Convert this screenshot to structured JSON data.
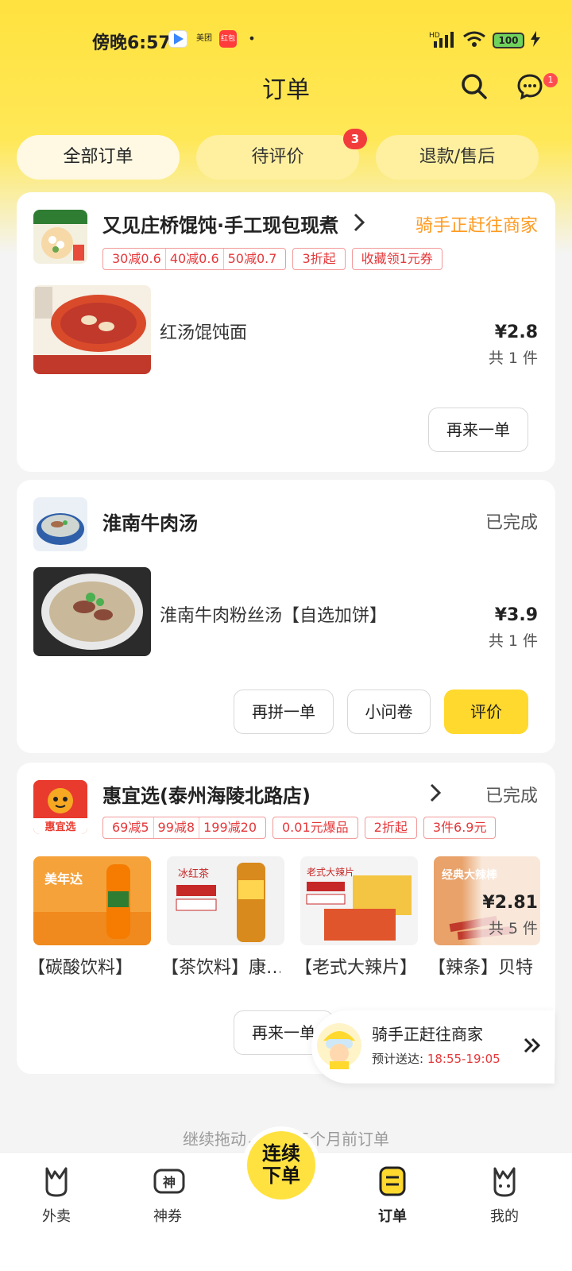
{
  "status_bar": {
    "time": "傍晚6:57",
    "app_meituan": "美团",
    "app_red": "红包",
    "dot": "•",
    "network": "HD",
    "battery": "100"
  },
  "header": {
    "title": "订单",
    "message_badge": "1"
  },
  "tabs": [
    {
      "label": "全部订单",
      "active": true
    },
    {
      "label": "待评价",
      "badge": "3"
    },
    {
      "label": "退款/售后"
    }
  ],
  "orders": [
    {
      "shop_name": "又见庄桥馄饨·手工现包现煮",
      "status": "骑手正赶往商家",
      "status_color": "#ff9a1f",
      "promos": [
        [
          "30减0.6",
          "40减0.6",
          "50减0.7"
        ],
        [
          "3折起"
        ],
        [
          "收藏领1元券"
        ]
      ],
      "item_name": "红汤馄饨面",
      "price": "¥2.8",
      "qty": "共 1 件",
      "buttons": [
        {
          "label": "再来一单"
        }
      ]
    },
    {
      "shop_name": "淮南牛肉汤",
      "status": "已完成",
      "item_name": "淮南牛肉粉丝汤【自选加饼】",
      "price": "¥3.9",
      "qty": "共 1 件",
      "buttons": [
        {
          "label": "再拼一单"
        },
        {
          "label": "小问卷"
        },
        {
          "label": "评价"
        }
      ]
    },
    {
      "shop_name": "惠宜选(泰州海陵北路店)",
      "status": "已完成",
      "logo_text": "惠宜选",
      "promos": [
        [
          "69减5",
          "99减8",
          "199减20"
        ],
        [
          "0.01元爆品"
        ],
        [
          "2折起"
        ],
        [
          "3件6.9元"
        ]
      ],
      "items": [
        {
          "caption": "【碳酸饮料】",
          "img_text": "美年达"
        },
        {
          "caption": "【茶饮料】康…",
          "img_text": "冰红茶"
        },
        {
          "caption": "【老式大辣片】",
          "img_text": "老式大辣片"
        },
        {
          "caption": "【辣条】贝特",
          "img_text": "经典大辣棒"
        }
      ],
      "price": "¥2.81",
      "qty": "共 5 件",
      "buttons": [
        {
          "label": "再来一单"
        }
      ]
    }
  ],
  "rider_toast": {
    "title": "骑手正赶往商家",
    "eta_label": "预计送达: ",
    "eta_time": "18:55-19:05"
  },
  "hint": "继续拖动，查看三个月前订单",
  "bottom_nav": {
    "items": [
      {
        "label": "外卖"
      },
      {
        "label": "神券"
      },
      {
        "label": "订单",
        "active": true
      },
      {
        "label": "我的"
      }
    ],
    "center_button": [
      "连续",
      "下单"
    ]
  },
  "colors": {
    "brand_yellow": "#ffe23f",
    "accent_red": "#e5383b",
    "status_orange": "#ff9a1f"
  }
}
